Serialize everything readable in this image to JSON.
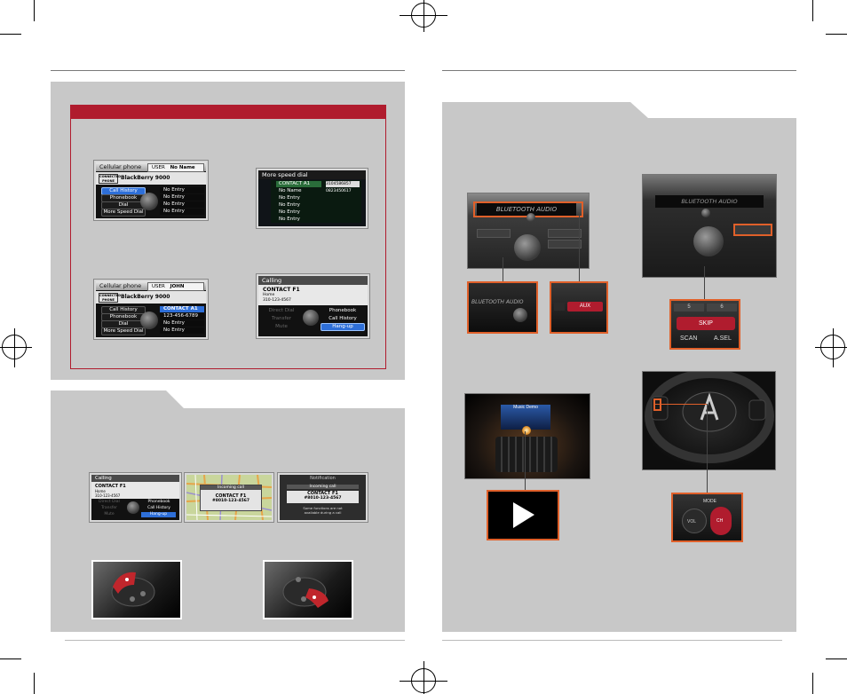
{
  "left_page": {
    "phone_screens": {
      "screen1": {
        "title": "Cellular phone",
        "user_label": "USER",
        "user_name": "No Name",
        "badge": "CONNECTED PHONE",
        "device": "BlackBerry 9000",
        "menu": [
          "Call History",
          "Phonebook",
          "Dial",
          "More Speed Dial"
        ],
        "entries": [
          "No Entry",
          "No Entry",
          "No Entry",
          "No Entry"
        ]
      },
      "screen2": {
        "title": "More speed dial",
        "rows": [
          "CONTACT A1",
          "No Name",
          "No Entry",
          "No Entry",
          "No Entry",
          "No Entry"
        ],
        "numbers": [
          "3104586857",
          "0823450617"
        ]
      },
      "screen3": {
        "title": "Cellular phone",
        "user_label": "USER",
        "user_name": "JOHN",
        "badge": "CONNECTED PHONE",
        "device": "BlackBerry 9000",
        "menu": [
          "Call History",
          "Phonebook",
          "Dial",
          "More Speed Dial"
        ],
        "entries": [
          "CONTACT A1",
          "123-456-6789",
          "No Entry",
          "No Entry"
        ]
      },
      "screen4": {
        "title": "Calling",
        "contact": "CONTACT F1",
        "type": "Home",
        "number": "310-123-4567",
        "left_options": [
          "Direct Dial",
          "Transfer",
          "Mute"
        ],
        "right_options": [
          "Phonebook",
          "Call History",
          "Hang-up"
        ]
      }
    },
    "incoming": {
      "calling": {
        "title": "Calling",
        "contact": "CONTACT F1",
        "type": "Home",
        "number": "310-123-4567",
        "left_options": [
          "Direct Dial",
          "Transfer",
          "Mute"
        ],
        "right_options": [
          "Phonebook",
          "Call History",
          "Hang-up"
        ]
      },
      "map_popup": {
        "header": "Incoming call",
        "contact": "CONTACT F1",
        "number": "#8010-123-4567"
      },
      "notification": {
        "title": "Notification",
        "header": "Incoming call",
        "contact": "CONTACT F1",
        "number": "#8010-123-4567",
        "note1": "Some functions are not",
        "note2": "available during a call"
      }
    }
  },
  "right_page": {
    "audio": {
      "display_text": "BLUETOOTH AUDIO",
      "aux_label": "AUX",
      "skip_label": "SKIP",
      "scan_label": "SCAN",
      "asel_label": "A.SEL",
      "preset_5": "5",
      "preset_6": "6",
      "mode_label": "MODE",
      "vol_label": "VOL",
      "ch_label": "CH",
      "phone_screen_title": "Music Demo"
    }
  },
  "colors": {
    "accent_red": "#b01c2e",
    "highlight_orange": "#e0602a",
    "panel_gray": "#c8c8c8"
  }
}
